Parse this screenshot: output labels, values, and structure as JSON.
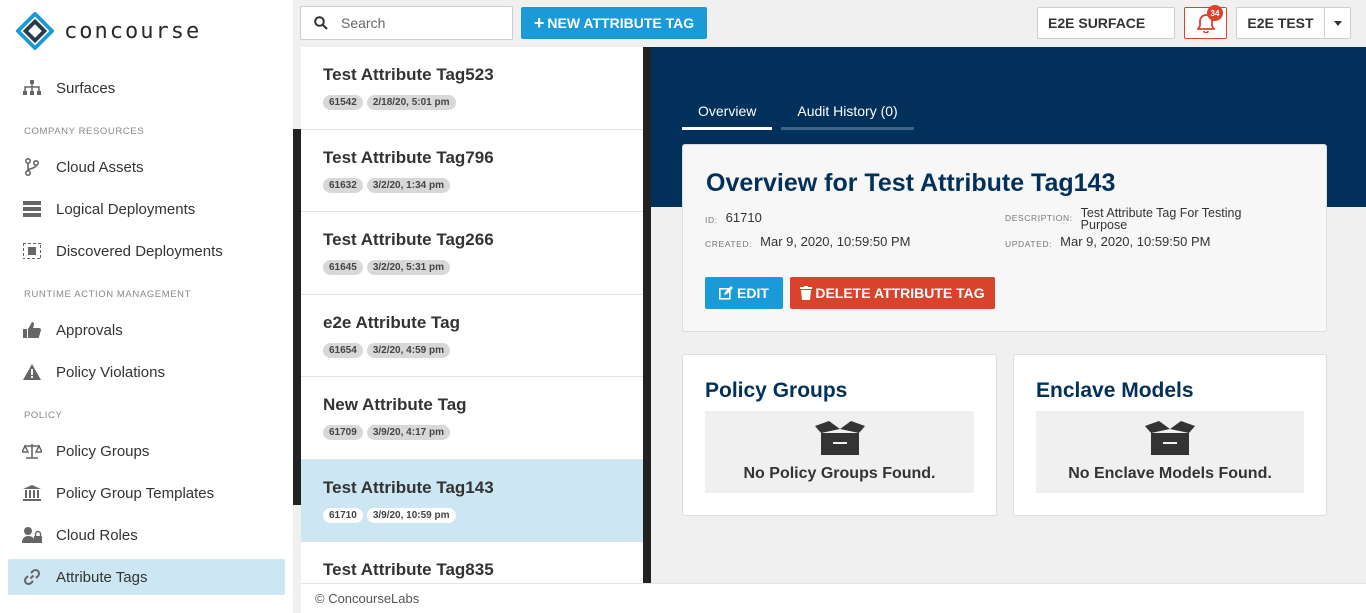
{
  "brand": {
    "name": "concourse"
  },
  "sidebar": {
    "top_item": {
      "label": "Surfaces",
      "icon": "sitemap-icon"
    },
    "sections": [
      {
        "label": "COMPANY RESOURCES",
        "items": [
          {
            "label": "Cloud Assets",
            "icon": "branch-icon"
          },
          {
            "label": "Logical Deployments",
            "icon": "server-icon"
          },
          {
            "label": "Discovered Deployments",
            "icon": "discovered-icon"
          }
        ]
      },
      {
        "label": "RUNTIME ACTION MANAGEMENT",
        "items": [
          {
            "label": "Approvals",
            "icon": "thumbs-up-icon"
          },
          {
            "label": "Policy Violations",
            "icon": "warning-icon"
          }
        ]
      },
      {
        "label": "POLICY",
        "items": [
          {
            "label": "Policy Groups",
            "icon": "balance-scale-icon"
          },
          {
            "label": "Policy Group Templates",
            "icon": "bank-icon"
          },
          {
            "label": "Cloud Roles",
            "icon": "user-lock-icon"
          },
          {
            "label": "Attribute Tags",
            "icon": "link-icon",
            "active": true
          }
        ]
      }
    ]
  },
  "topbar": {
    "search_placeholder": "Search",
    "new_button": "NEW ATTRIBUTE TAG",
    "surface": "E2E SURFACE",
    "notifications_count": "34",
    "user": "E2E TEST"
  },
  "list": [
    {
      "title": "Test Attribute Tag523",
      "id": "61542",
      "date": "2/18/20, 5:01 pm"
    },
    {
      "title": "Test Attribute Tag796",
      "id": "61632",
      "date": "3/2/20, 1:34 pm"
    },
    {
      "title": "Test Attribute Tag266",
      "id": "61645",
      "date": "3/2/20, 5:31 pm"
    },
    {
      "title": "e2e Attribute Tag",
      "id": "61654",
      "date": "3/2/20, 4:59 pm"
    },
    {
      "title": "New Attribute Tag",
      "id": "61709",
      "date": "3/9/20, 4:17 pm"
    },
    {
      "title": "Test Attribute Tag143",
      "id": "61710",
      "date": "3/9/20, 10:59 pm",
      "selected": true
    },
    {
      "title": "Test Attribute Tag835",
      "id": "",
      "date": ""
    }
  ],
  "detail": {
    "tabs": [
      {
        "label": "Overview",
        "active": true
      },
      {
        "label": "Audit History (0)"
      }
    ],
    "title": "Overview for Test Attribute Tag143",
    "id_label": "ID:",
    "id": "61710",
    "created_label": "CREATED:",
    "created": "Mar 9, 2020, 10:59:50 PM",
    "description_label": "DESCRIPTION:",
    "description": "Test Attribute Tag For Testing Purpose",
    "updated_label": "UPDATED:",
    "updated": "Mar 9, 2020, 10:59:50 PM",
    "edit_button": "EDIT",
    "delete_button": "DELETE ATTRIBUTE TAG",
    "policy_groups": {
      "title": "Policy Groups",
      "empty": "No Policy Groups Found."
    },
    "enclave_models": {
      "title": "Enclave Models",
      "empty": "No Enclave Models Found."
    }
  },
  "footer": {
    "text": "© ConcourseLabs"
  },
  "colors": {
    "accent": "#1a9bd7",
    "danger": "#d9432b",
    "navy": "#01305a",
    "selected": "#cde6f3"
  }
}
